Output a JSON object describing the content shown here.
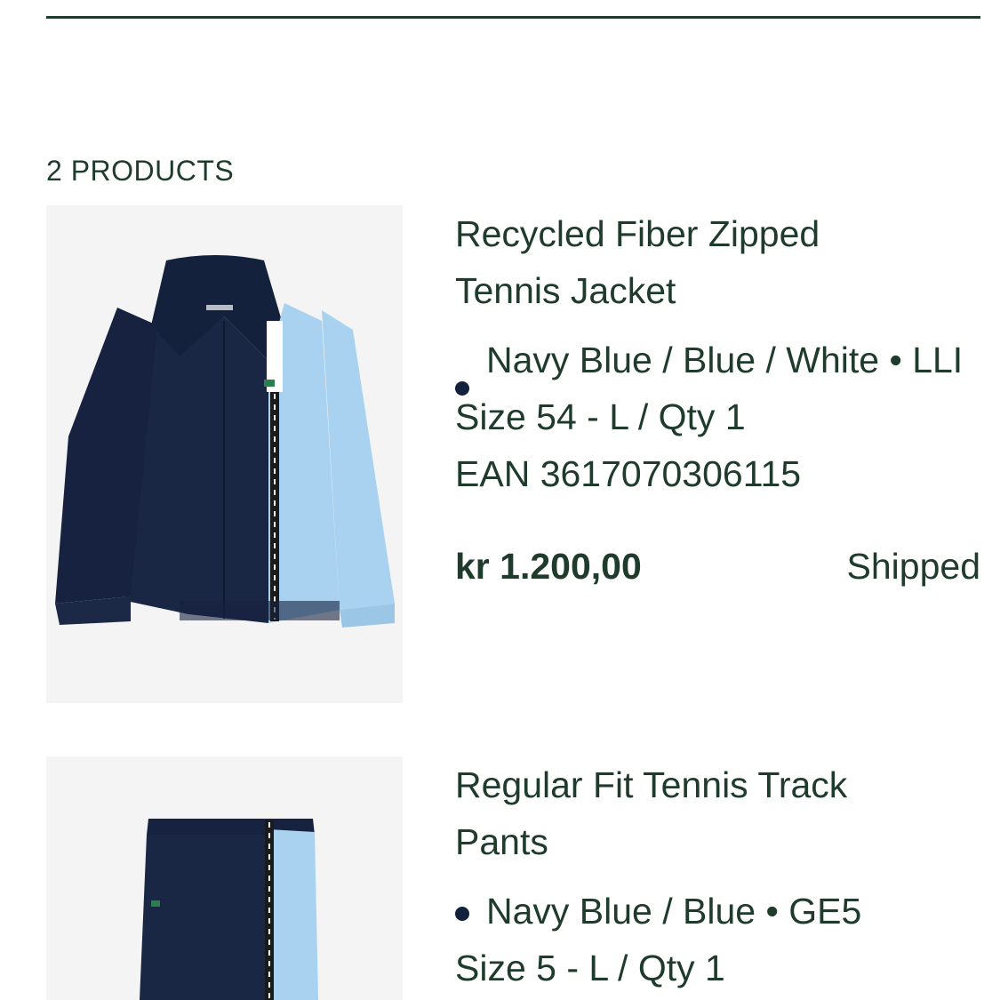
{
  "order": {
    "products_label": "2 PRODUCTS",
    "items": [
      {
        "title_line1": "Recycled Fiber Zipped",
        "title_line2": "Tennis Jacket",
        "color_text": "Navy Blue / Blue / White • LLI",
        "size_qty": "Size 54 - L / Qty 1",
        "ean": "EAN 3617070306115",
        "price": "kr 1.200,00",
        "status": "Shipped",
        "image_icon": "tennis-jacket-image"
      },
      {
        "title_line1": "Regular Fit Tennis Track",
        "title_line2": "Pants",
        "color_text": "Navy Blue / Blue • GE5",
        "size_qty": "Size 5 - L / Qty 1",
        "image_icon": "track-pants-image"
      }
    ]
  },
  "colors": {
    "text": "#1f3b2c",
    "navy": "#14213d",
    "light_blue": "#a9d2f0",
    "image_bg": "#f4f4f4"
  }
}
